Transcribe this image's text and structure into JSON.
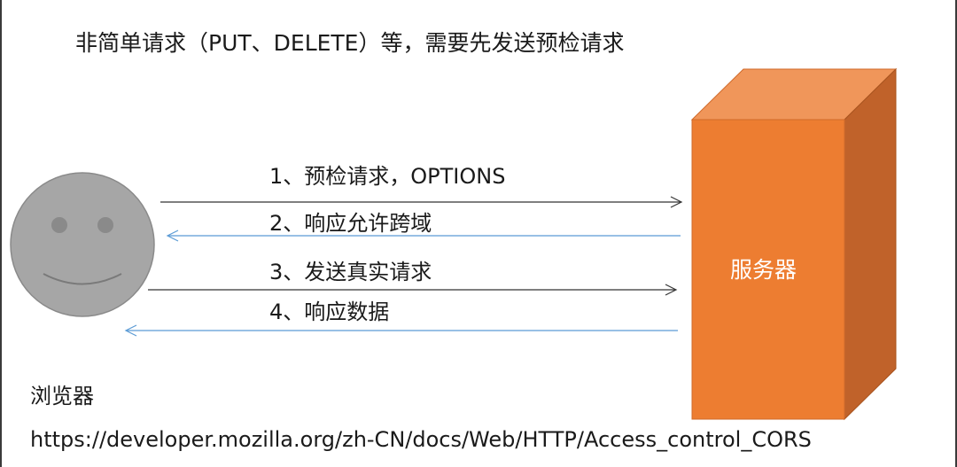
{
  "title": "非简单请求（PUT、DELETE）等，需要先发送预检请求",
  "steps": [
    {
      "label": "1、预检请求，OPTIONS",
      "direction": "to-server"
    },
    {
      "label": "2、响应允许跨域",
      "direction": "to-browser"
    },
    {
      "label": "3、发送真实请求",
      "direction": "to-server"
    },
    {
      "label": "4、响应数据",
      "direction": "to-browser"
    }
  ],
  "browser": {
    "label": "浏览器"
  },
  "server": {
    "label": "服务器"
  },
  "reference_url": "https://developer.mozilla.org/zh-CN/docs/Web/HTTP/Access_control_CORS",
  "colors": {
    "server_front": "#ed7d31",
    "server_top": "#f0965a",
    "server_side": "#c0622a",
    "face": "#a6a6a6",
    "request_arrow": "#333333",
    "response_arrow": "#5b9bd5"
  }
}
